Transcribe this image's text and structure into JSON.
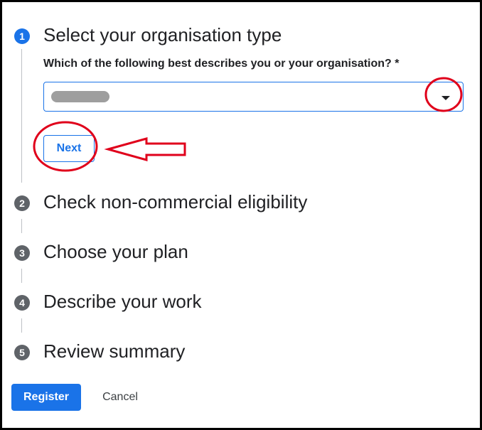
{
  "steps": [
    {
      "number": "1",
      "title": "Select your organisation type",
      "active": true
    },
    {
      "number": "2",
      "title": "Check non-commercial eligibility",
      "active": false
    },
    {
      "number": "3",
      "title": "Choose your plan",
      "active": false
    },
    {
      "number": "4",
      "title": "Describe your work",
      "active": false
    },
    {
      "number": "5",
      "title": "Review summary",
      "active": false
    }
  ],
  "organisation_question": {
    "label": "Which of the following best describes you or your organisation? *",
    "selected_value_redacted": true,
    "dropdown_icon": "caret-down-icon"
  },
  "next_button_label": "Next",
  "footer": {
    "register_label": "Register",
    "cancel_label": "Cancel"
  },
  "annotations": {
    "color": "#e0001b",
    "arrow_icon": "left-arrow-icon"
  },
  "colors": {
    "accent": "#1a73e8",
    "inactive_step": "#5f6368",
    "text": "#202124"
  }
}
